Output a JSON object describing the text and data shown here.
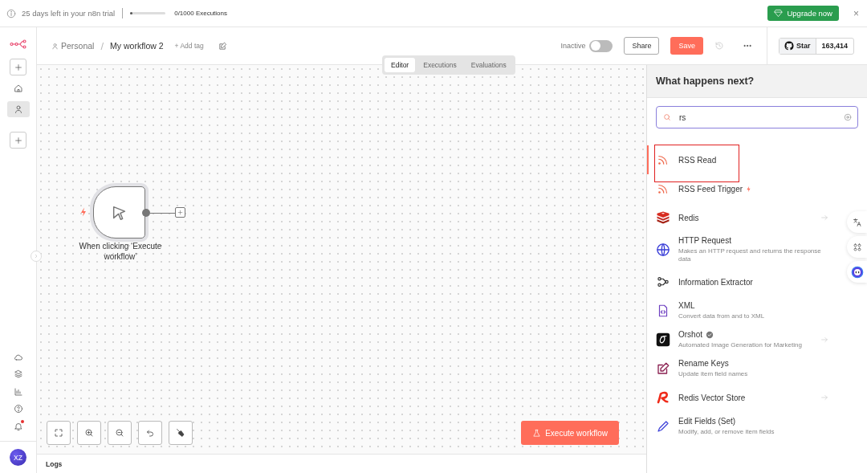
{
  "trial_banner": {
    "message": "25 days left in your n8n trial",
    "executions": {
      "level": 0.02,
      "label": "0/1000 Executions"
    },
    "upgrade_button": "Upgrade now",
    "close": "×"
  },
  "sidebar": {
    "items": [
      {
        "kind": "home",
        "selected": false
      },
      {
        "kind": "person",
        "selected": true
      }
    ],
    "bottom_items": [
      {
        "kind": "cloud"
      },
      {
        "kind": "templates"
      },
      {
        "kind": "insights"
      },
      {
        "kind": "help"
      },
      {
        "kind": "bell",
        "unread": true
      }
    ],
    "avatar": "XZ"
  },
  "header": {
    "breadcrumb": "Personal",
    "separator": "/",
    "workflow_name": "My workflow 2",
    "add_tag": "+ Add tag",
    "active_label": "Inactive",
    "active": false,
    "share": "Share",
    "save": "Save"
  },
  "github": {
    "label": "Star",
    "count": "163,414"
  },
  "tabs": [
    {
      "label": "Editor",
      "selected": true
    },
    {
      "label": "Executions",
      "selected": false
    },
    {
      "label": "Evaluations",
      "selected": false
    }
  ],
  "canvas": {
    "node": {
      "label": "When clicking ‘Execute workflow’",
      "trigger": true
    },
    "execute_button": "Execute workflow",
    "logs": "Logs"
  },
  "panel": {
    "title": "What happens next?",
    "search": {
      "value": "rs"
    },
    "items": [
      {
        "name": "RSS Read",
        "kind": "rss",
        "selected": true,
        "highlighted": true,
        "trigger": false,
        "verified": false,
        "arrow": false
      },
      {
        "name": "RSS Feed Trigger",
        "kind": "rss",
        "selected": false,
        "highlighted": false,
        "trigger": true,
        "verified": false,
        "arrow": false
      },
      {
        "name": "Redis",
        "kind": "redis",
        "selected": false,
        "highlighted": false,
        "trigger": false,
        "verified": false,
        "arrow": true
      },
      {
        "name": "HTTP Request",
        "description": "Makes an HTTP request and returns the response data",
        "kind": "globe",
        "selected": false,
        "highlighted": false,
        "trigger": false,
        "verified": false,
        "arrow": false
      },
      {
        "name": "Information Extractor",
        "kind": "nodes",
        "selected": false,
        "highlighted": false,
        "trigger": false,
        "verified": false,
        "arrow": false
      },
      {
        "name": "XML",
        "description": "Convert data from and to XML",
        "kind": "file",
        "selected": false,
        "highlighted": false,
        "trigger": false,
        "verified": false,
        "arrow": false
      },
      {
        "name": "Orshot",
        "description": "Automated Image Generation for Marketing",
        "kind": "orshot",
        "selected": false,
        "highlighted": false,
        "trigger": false,
        "verified": true,
        "arrow": true
      },
      {
        "name": "Rename Keys",
        "description": "Update item field names",
        "kind": "edit",
        "selected": false,
        "highlighted": false,
        "trigger": false,
        "verified": false,
        "arrow": false
      },
      {
        "name": "Redis Vector Store",
        "kind": "redisvs",
        "selected": false,
        "highlighted": false,
        "trigger": false,
        "verified": false,
        "arrow": true
      },
      {
        "name": "Edit Fields (Set)",
        "description": "Modify, add, or remove item fields",
        "kind": "pen",
        "selected": false,
        "highlighted": false,
        "trigger": false,
        "verified": false,
        "arrow": false
      }
    ]
  }
}
